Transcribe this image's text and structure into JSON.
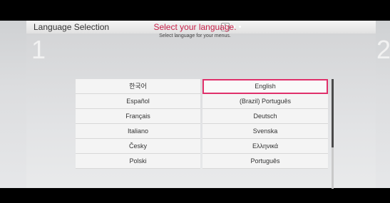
{
  "header": {
    "title": "Language Selection",
    "current_page": "1"
  },
  "steps": {
    "current": "1",
    "next": "2"
  },
  "prompt": {
    "heading": "Select your language.",
    "subheading": "Select language for your menus."
  },
  "languages": {
    "left": [
      "한국어",
      "Español",
      "Français",
      "Italiano",
      "Česky",
      "Polski"
    ],
    "right": [
      "English",
      "(Brazil) Português",
      "Deutsch",
      "Svenska",
      "Ελληνικά",
      "Português"
    ],
    "selected": "English"
  },
  "colors": {
    "accent": "#c8214a",
    "selection_border": "#e0306a"
  }
}
